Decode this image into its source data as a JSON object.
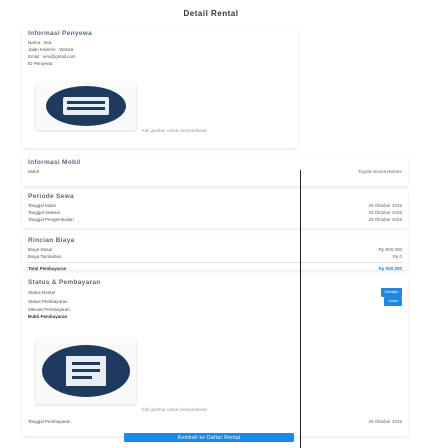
{
  "header": {
    "title": "Detail Rental"
  },
  "renter": {
    "title": "Informasi Penyewa",
    "name_line": "Nama : Iera",
    "address_line": "Jalan Kelerrin : Wanita",
    "email_line": "Email : iera@gmail.com",
    "id_line": "ID Penyewa",
    "hint": "Klik gambar untuk memperbesar"
  },
  "car": {
    "title": "Informasi Mobil",
    "label": "Mobil",
    "value": "Toyota Innova Reborn"
  },
  "period": {
    "title": "Periode Sewa",
    "rows": [
      {
        "label": "Tanggal Mulai",
        "value": "26 Oktober 2025"
      },
      {
        "label": "Tanggal Selesai",
        "value": "29 Oktober 2025"
      },
      {
        "label": "Tanggal Pengembalian",
        "value": "29 Oktober 2025"
      }
    ]
  },
  "costs": {
    "title": "Rincian Biaya",
    "rows": [
      {
        "label": "Biaya Dasar",
        "value": "Rp 900.000"
      },
      {
        "label": "Biaya Tambahan",
        "value": "Rp 0"
      }
    ],
    "total_label": "Total Pembayaran",
    "total_value": "Rp 900.000"
  },
  "status": {
    "title": "Status & Pembayaran",
    "rows": [
      {
        "label": "Status Rental",
        "badge": "Disetujui"
      },
      {
        "label": "Status Pembayaran",
        "badge": "Lunas"
      },
      {
        "label": "Metode Pembayaran",
        "badge": ""
      }
    ],
    "proof_label": "Bukti Pembayaran",
    "hint": "Klik gambar untuk memperbesar",
    "paid_label": "Tanggal Pembayaran",
    "paid_value": "26 Oktober 2025"
  },
  "actions": {
    "back_label": "Kembali ke Daftar Rental"
  },
  "colors": {
    "accent": "#1e88e5",
    "icon_dark": "#1f3a5f"
  }
}
